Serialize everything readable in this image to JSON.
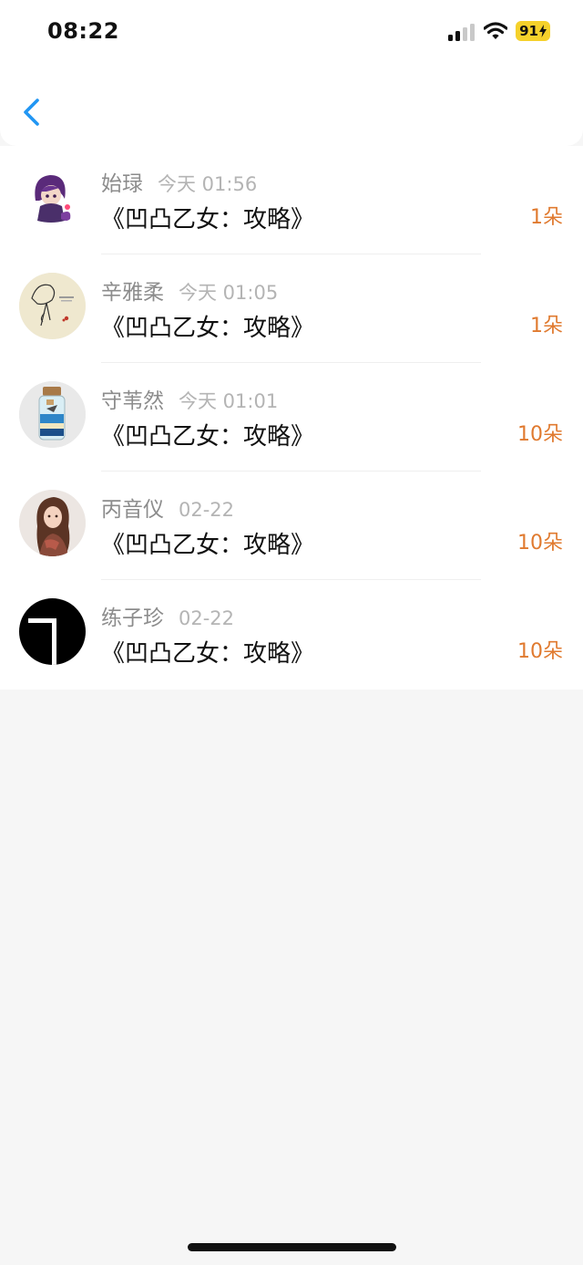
{
  "status_bar": {
    "time": "08:22",
    "battery": "91"
  },
  "nav": {
    "back_icon": "chevron-left-icon",
    "accent": "#2196f3"
  },
  "gift_list": [
    {
      "name": "始琭",
      "time": "今天 01:56",
      "title": "《凹凸乙女：攻略》",
      "amount": "1朵",
      "avatar": "anime-character-avatar"
    },
    {
      "name": "辛雅柔",
      "time": "今天 01:05",
      "title": "《凹凸乙女：攻略》",
      "amount": "1朵",
      "avatar": "sketch-drawing-avatar"
    },
    {
      "name": "守苇然",
      "time": "今天 01:01",
      "title": "《凹凸乙女：攻略》",
      "amount": "10朵",
      "avatar": "glass-jar-avatar"
    },
    {
      "name": "丙音仪",
      "time": "02-22",
      "title": "《凹凸乙女：攻略》",
      "amount": "10朵",
      "avatar": "portrait-photo-avatar"
    },
    {
      "name": "练子珍",
      "time": "02-22",
      "title": "《凹凸乙女：攻略》",
      "amount": "10朵",
      "avatar": "black-shape-avatar"
    }
  ],
  "colors": {
    "amount": "#e07a2f",
    "name": "#8c8c8c",
    "time": "#b4b4b4",
    "background": "#f6f6f6"
  }
}
